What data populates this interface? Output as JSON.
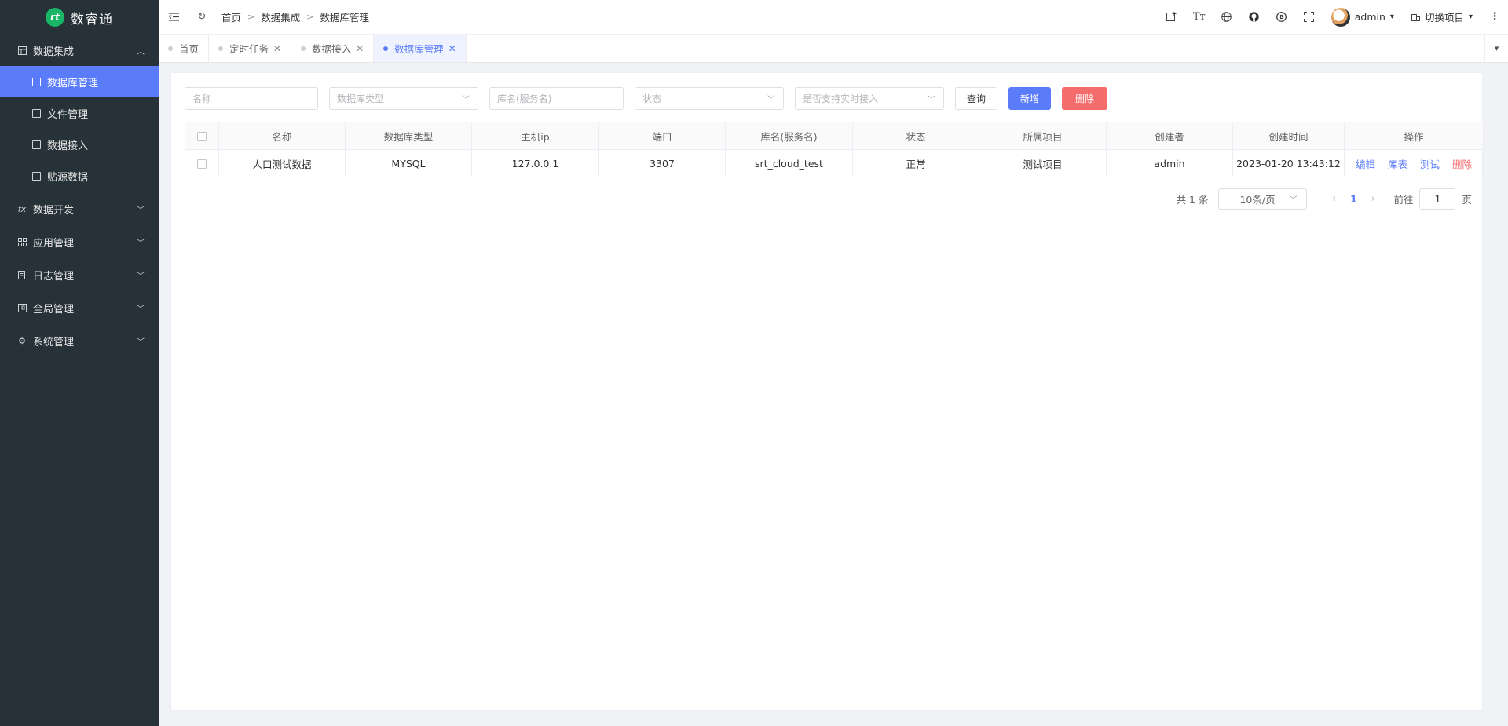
{
  "app": {
    "title": "数睿通"
  },
  "sidebar": {
    "groups": [
      {
        "label": "数据集成",
        "icon": "grid-icon",
        "expanded": true,
        "items": [
          {
            "label": "数据库管理",
            "active": true
          },
          {
            "label": "文件管理"
          },
          {
            "label": "数据接入"
          },
          {
            "label": "贴源数据"
          }
        ]
      },
      {
        "label": "数据开发",
        "icon": "fx-icon"
      },
      {
        "label": "应用管理",
        "icon": "apps-icon"
      },
      {
        "label": "日志管理",
        "icon": "log-icon"
      },
      {
        "label": "全局管理",
        "icon": "global-icon"
      },
      {
        "label": "系统管理",
        "icon": "gear-icon"
      }
    ]
  },
  "header": {
    "breadcrumb": [
      "首页",
      "数据集成",
      "数据库管理"
    ],
    "user": "admin",
    "project_switch": "切换项目"
  },
  "tabs": [
    {
      "label": "首页",
      "closable": false
    },
    {
      "label": "定时任务",
      "closable": true
    },
    {
      "label": "数据接入",
      "closable": true
    },
    {
      "label": "数据库管理",
      "closable": true,
      "active": true
    }
  ],
  "filters": {
    "name_placeholder": "名称",
    "dbtype_placeholder": "数据库类型",
    "dbname_placeholder": "库名(服务名)",
    "status_placeholder": "状态",
    "realtime_placeholder": "是否支持实时接入",
    "query_label": "查询",
    "add_label": "新增",
    "delete_label": "删除"
  },
  "table": {
    "columns": [
      "名称",
      "数据库类型",
      "主机ip",
      "端口",
      "库名(服务名)",
      "状态",
      "所属项目",
      "创建者",
      "创建时间",
      "操作"
    ],
    "rows": [
      {
        "name": "人口测试数据",
        "dbtype": "MYSQL",
        "host": "127.0.0.1",
        "port": "3307",
        "dbname": "srt_cloud_test",
        "status": "正常",
        "project": "测试项目",
        "creator": "admin",
        "created": "2023-01-20 13:43:12"
      }
    ],
    "actions": {
      "edit": "编辑",
      "tables": "库表",
      "test": "测试",
      "delete": "删除"
    }
  },
  "pagination": {
    "total_text": "共 1 条",
    "page_size": "10条/页",
    "current_page": "1",
    "goto_label": "前往",
    "goto_value": "1",
    "page_unit": "页"
  }
}
